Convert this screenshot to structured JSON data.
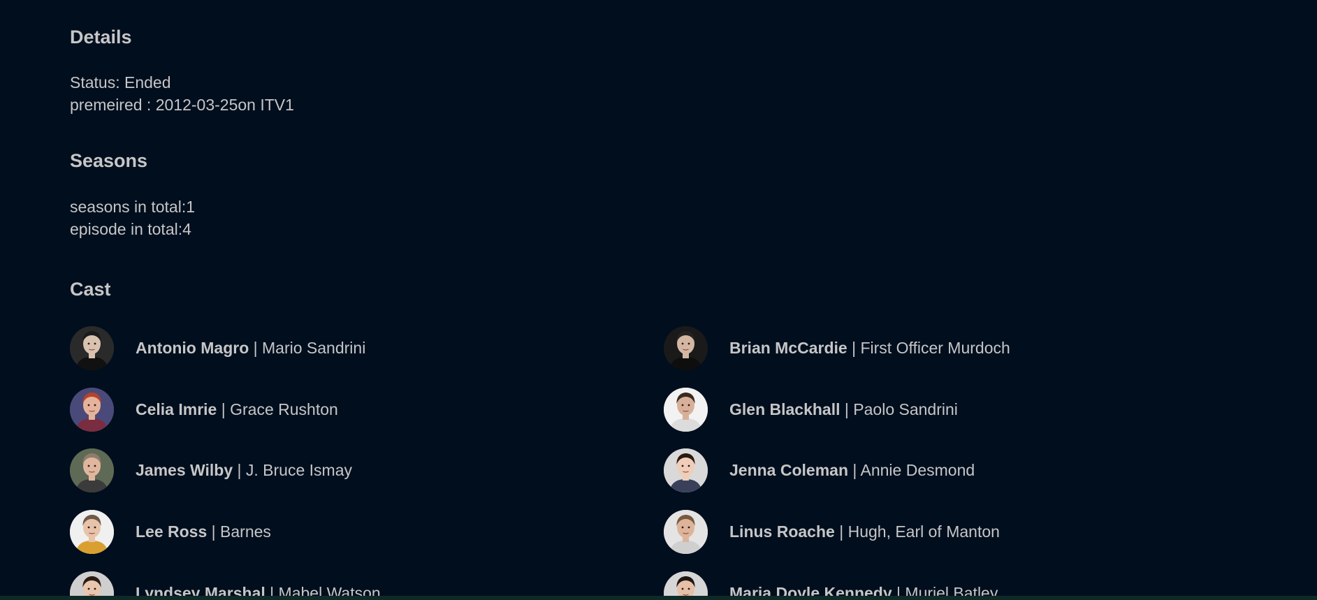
{
  "details": {
    "title": "Details",
    "status_label": "Status:",
    "status_value": "Ended",
    "premiered_label": "premeired :",
    "premiered_date": "2012-03-25",
    "premiered_on": "on",
    "network": "ITV1"
  },
  "seasons": {
    "title": "Seasons",
    "seasons_label": "seasons in total:",
    "seasons_count": "1",
    "episodes_label": "episode in total:",
    "episodes_count": "4"
  },
  "cast": {
    "title": "Cast",
    "separator": "|",
    "members": [
      {
        "actor": "Antonio Magro",
        "role": "Mario Sandrini",
        "bg": "#2a2a2a",
        "skin": "#d9c2b0",
        "hair": "#1b1b1b",
        "shirt": "#111111"
      },
      {
        "actor": "Brian McCardie",
        "role": "First Officer Murdoch",
        "bg": "#1a1a1a",
        "skin": "#d3b7a3",
        "hair": "#222222",
        "shirt": "#0e0e0e"
      },
      {
        "actor": "Celia Imrie",
        "role": "Grace Rushton",
        "bg": "#4a4a7a",
        "skin": "#e5b39c",
        "hair": "#b5432a",
        "shirt": "#7a2d40"
      },
      {
        "actor": "Glen Blackhall",
        "role": "Paolo Sandrini",
        "bg": "#f2f2f2",
        "skin": "#d8b09a",
        "hair": "#3a2a20",
        "shirt": "#dcdcdc"
      },
      {
        "actor": "James Wilby",
        "role": "J. Bruce Ismay",
        "bg": "#5e6a55",
        "skin": "#dfb79e",
        "hair": "#8d7d6a",
        "shirt": "#3b3b3b"
      },
      {
        "actor": "Jenna Coleman",
        "role": "Annie Desmond",
        "bg": "#d9d9d9",
        "skin": "#efcdb9",
        "hair": "#2b1a12",
        "shirt": "#3a3f5a"
      },
      {
        "actor": "Lee Ross",
        "role": "Barnes",
        "bg": "#f0f0f0",
        "skin": "#e8c3a9",
        "hair": "#6d5a48",
        "shirt": "#d9a030"
      },
      {
        "actor": "Linus Roache",
        "role": "Hugh, Earl of Manton",
        "bg": "#e4e4e4",
        "skin": "#ddb49a",
        "hair": "#7a5a3e",
        "shirt": "#cfcfcf"
      },
      {
        "actor": "Lyndsey Marshal",
        "role": "Mabel Watson",
        "bg": "#cfcfcf",
        "skin": "#e9c6ae",
        "hair": "#2a1c15",
        "shirt": "#555555"
      },
      {
        "actor": "Maria Doyle Kennedy",
        "role": "Muriel Batley",
        "bg": "#d6d6d6",
        "skin": "#e6c0a8",
        "hair": "#1f1613",
        "shirt": "#444444"
      }
    ]
  },
  "colors": {
    "background": "#000e1e",
    "text": "#c6c6c6",
    "bottom_strip": "#0e2a26"
  }
}
